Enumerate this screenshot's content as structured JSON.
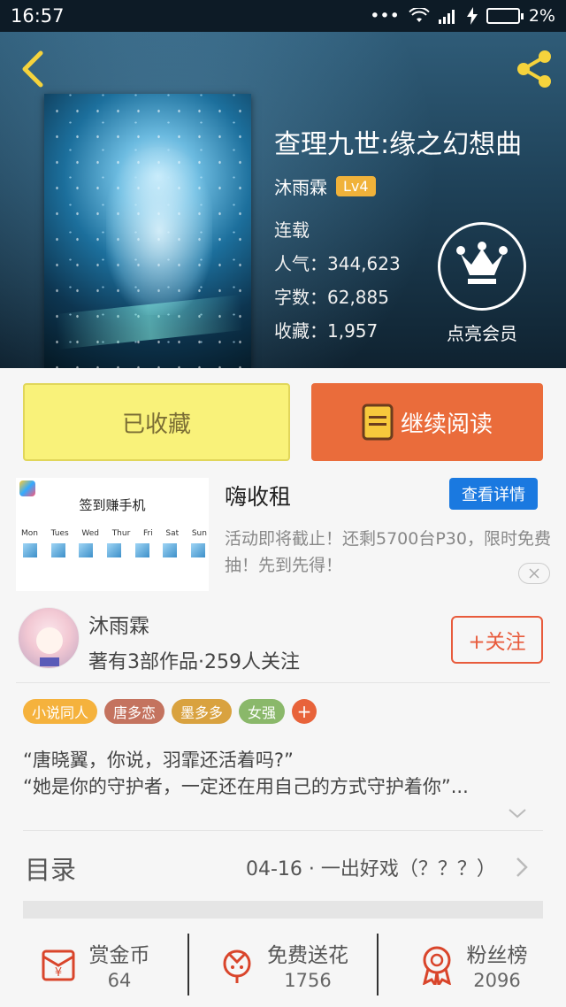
{
  "status_bar": {
    "time": "16:57",
    "dots": "•••",
    "battery": "2%"
  },
  "book": {
    "title": "查理九世:缘之幻想曲",
    "author": "沐雨霖",
    "level": "Lv4",
    "status": "连载",
    "popularity": "人气：344,623",
    "word_count": "字数：62,885",
    "favorites": "收藏：1,957"
  },
  "vip": {
    "label": "点亮会员"
  },
  "actions": {
    "collected_label": "已收藏",
    "continue_label": "继续阅读"
  },
  "ad": {
    "image_title": "签到赚手机",
    "days": [
      "Mon",
      "Tues",
      "Wed",
      "Thur",
      "Fri",
      "Sat",
      "Sun"
    ],
    "title": "嗨收租",
    "detail_label": "查看详情",
    "description": "活动即将截止！还剩5700台P30，限时免费抽！先到先得！",
    "close_icon": "close-icon"
  },
  "author_card": {
    "name": "沐雨霖",
    "stats": "著有3部作品·259人关注",
    "follow_label": "+关注"
  },
  "tags": [
    {
      "label": "小说同人",
      "color": "#f5b23d"
    },
    {
      "label": "唐多恋",
      "color": "#c4735f"
    },
    {
      "label": "墨多多",
      "color": "#d9a23f"
    },
    {
      "label": "女强",
      "color": "#8ab86a"
    }
  ],
  "tag_more": "+",
  "intro": {
    "line1": "“唐晓翼，你说，羽霏还活着吗?”",
    "line2": "“她是你的守护者，一定还在用自己的方式守护着你”..."
  },
  "toc": {
    "label": "目录",
    "latest": "04-16 · 一出好戏（？？？）"
  },
  "bottom_bar": [
    {
      "label": "赏金币",
      "count": "64",
      "icon": "coin-envelope-icon"
    },
    {
      "label": "免费送花",
      "count": "1756",
      "icon": "flower-icon"
    },
    {
      "label": "粉丝榜",
      "count": "2096",
      "icon": "medal-icon"
    }
  ],
  "colors": {
    "accent_orange": "#ea6c3b",
    "collected_yellow": "#f9f27a",
    "link_blue": "#1a79e0",
    "icon_red": "#d9452b"
  }
}
